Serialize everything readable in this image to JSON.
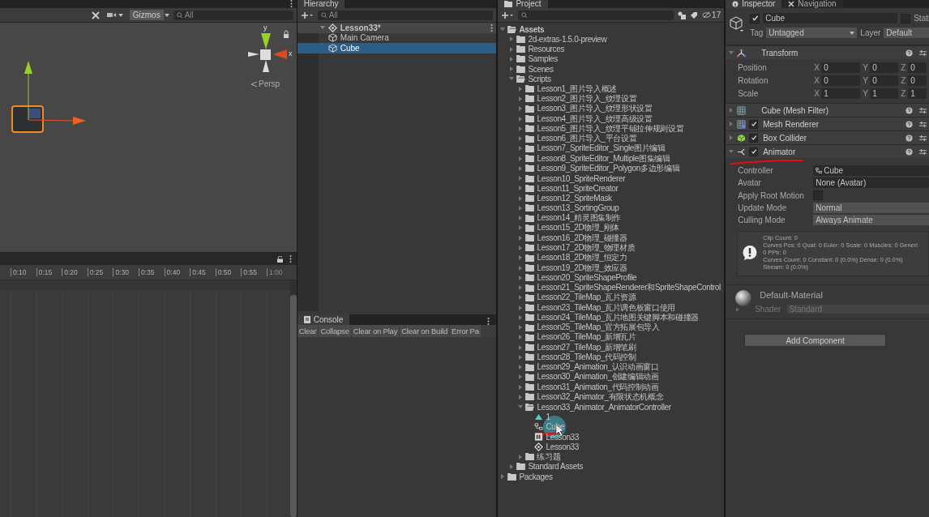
{
  "scene": {
    "toolbar": {
      "gizmos": "Gizmos",
      "search_placeholder": "All"
    },
    "orientation_labels": [
      "y",
      "x"
    ],
    "projection": "Persp"
  },
  "timeline": {
    "ticks": [
      "0:10",
      "0:15",
      "0:20",
      "0:25",
      "0:30",
      "0:35",
      "0:40",
      "0:45",
      "0:50",
      "0:55",
      "1:00"
    ]
  },
  "hierarchy": {
    "title": "Hierarchy",
    "search_placeholder": "All",
    "items": [
      {
        "kind": "scene",
        "label": "Lesson33*",
        "expanded": true,
        "selected": false,
        "children": [
          {
            "kind": "gameobject",
            "label": "Main Camera",
            "selected": false
          },
          {
            "kind": "gameobject",
            "label": "Cube",
            "selected": true
          }
        ]
      }
    ]
  },
  "console": {
    "title": "Console",
    "buttons": [
      "Clear",
      "Collapse",
      "Clear on Play",
      "Clear on Build",
      "Error Pa"
    ]
  },
  "project": {
    "title": "Project",
    "hidden_count": "17",
    "tree": [
      {
        "kind": "folder",
        "label": "Assets",
        "expanded": true,
        "children": [
          {
            "kind": "folder",
            "label": "2d-extras-1.5.0-preview",
            "expanded": false
          },
          {
            "kind": "folder",
            "label": "Resources",
            "expanded": false
          },
          {
            "kind": "folder",
            "label": "Samples",
            "expanded": false
          },
          {
            "kind": "folder",
            "label": "Scenes",
            "expanded": false
          },
          {
            "kind": "folder",
            "label": "Scripts",
            "expanded": true,
            "children": [
              {
                "kind": "folder",
                "label": "Lesson1_图片导入概述",
                "expanded": false
              },
              {
                "kind": "folder",
                "label": "Lesson2_图片导入_纹理设置",
                "expanded": false
              },
              {
                "kind": "folder",
                "label": "Lesson3_图片导入_纹理形状设置",
                "expanded": false
              },
              {
                "kind": "folder",
                "label": "Lesson4_图片导入_纹理高级设置",
                "expanded": false
              },
              {
                "kind": "folder",
                "label": "Lesson5_图片导入_纹理平铺拉伸规则设置",
                "expanded": false
              },
              {
                "kind": "folder",
                "label": "Lesson6_图片导入_平台设置",
                "expanded": false
              },
              {
                "kind": "folder",
                "label": "Lesson7_SpriteEditor_Single图片编辑",
                "expanded": false
              },
              {
                "kind": "folder",
                "label": "Lesson8_SpriteEditor_Multiple图集编辑",
                "expanded": false
              },
              {
                "kind": "folder",
                "label": "Lesson9_SpriteEditor_Polygon多边形编辑",
                "expanded": false
              },
              {
                "kind": "folder",
                "label": "Lesson10_SpriteRenderer",
                "expanded": false
              },
              {
                "kind": "folder",
                "label": "Lesson11_SpriteCreator",
                "expanded": false
              },
              {
                "kind": "folder",
                "label": "Lesson12_SpriteMask",
                "expanded": false
              },
              {
                "kind": "folder",
                "label": "Lesson13_SortingGroup",
                "expanded": false
              },
              {
                "kind": "folder",
                "label": "Lesson14_精灵图集制作",
                "expanded": false
              },
              {
                "kind": "folder",
                "label": "Lesson15_2D物理_刚体",
                "expanded": false
              },
              {
                "kind": "folder",
                "label": "Lesson16_2D物理_碰撞器",
                "expanded": false
              },
              {
                "kind": "folder",
                "label": "Lesson17_2D物理_物理材质",
                "expanded": false
              },
              {
                "kind": "folder",
                "label": "Lesson18_2D物理_恒定力",
                "expanded": false
              },
              {
                "kind": "folder",
                "label": "Lesson19_2D物理_效应器",
                "expanded": false
              },
              {
                "kind": "folder",
                "label": "Lesson20_SpriteShapeProfile",
                "expanded": false
              },
              {
                "kind": "folder",
                "label": "Lesson21_SpriteShapeRenderer和SpriteShapeControl",
                "expanded": false
              },
              {
                "kind": "folder",
                "label": "Lesson22_TileMap_瓦片资源",
                "expanded": false
              },
              {
                "kind": "folder",
                "label": "Lesson23_TileMap_瓦片调色板窗口使用",
                "expanded": false
              },
              {
                "kind": "folder",
                "label": "Lesson24_TileMap_瓦片地图关键脚本和碰撞器",
                "expanded": false
              },
              {
                "kind": "folder",
                "label": "Lesson25_TileMap_官方拓展包导入",
                "expanded": false
              },
              {
                "kind": "folder",
                "label": "Lesson26_TileMap_新增瓦片",
                "expanded": false
              },
              {
                "kind": "folder",
                "label": "Lesson27_TileMap_新增笔刷",
                "expanded": false
              },
              {
                "kind": "folder",
                "label": "Lesson28_TileMap_代码控制",
                "expanded": false
              },
              {
                "kind": "folder",
                "label": "Lesson29_Animation_认识动画窗口",
                "expanded": false
              },
              {
                "kind": "folder",
                "label": "Lesson30_Animation_创建编辑动画",
                "expanded": false
              },
              {
                "kind": "folder",
                "label": "Lesson31_Animation_代码控制动画",
                "expanded": false
              },
              {
                "kind": "folder",
                "label": "Lesson32_Animator_有限状态机概念",
                "expanded": false
              },
              {
                "kind": "folder",
                "label": "Lesson33_Animator_AnimatorController",
                "expanded": true,
                "children": [
                  {
                    "kind": "clip",
                    "label": "1"
                  },
                  {
                    "kind": "controller",
                    "label": "Cube"
                  },
                  {
                    "kind": "script",
                    "label": "Lesson33"
                  },
                  {
                    "kind": "scene",
                    "label": "Lesson33"
                  }
                ]
              },
              {
                "kind": "folder",
                "label": "练习题",
                "expanded": false
              }
            ]
          },
          {
            "kind": "folder",
            "label": "Standard Assets",
            "expanded": false
          }
        ]
      },
      {
        "kind": "folder",
        "label": "Packages",
        "expanded": false
      }
    ]
  },
  "inspector": {
    "tabs": [
      {
        "label": "Inspector",
        "selected": true
      },
      {
        "label": "Navigation",
        "selected": false
      }
    ],
    "object": {
      "active": true,
      "name": "Cube",
      "static": false,
      "static_label": "Stati",
      "tag_label": "Tag",
      "tag": "Untagged",
      "layer_label": "Layer",
      "layer": "Default"
    },
    "components": [
      {
        "kind": "transform",
        "title": "Transform",
        "expanded": true,
        "rows": [
          {
            "label": "Position",
            "values": [
              {
                "axis": "X",
                "value": "0"
              },
              {
                "axis": "Y",
                "value": "0"
              },
              {
                "axis": "Z",
                "value": "0"
              }
            ]
          },
          {
            "label": "Rotation",
            "values": [
              {
                "axis": "X",
                "value": "0"
              },
              {
                "axis": "Y",
                "value": "0"
              },
              {
                "axis": "Z",
                "value": "0"
              }
            ]
          },
          {
            "label": "Scale",
            "values": [
              {
                "axis": "X",
                "value": "1"
              },
              {
                "axis": "Y",
                "value": "1"
              },
              {
                "axis": "Z",
                "value": "1"
              }
            ]
          }
        ]
      },
      {
        "kind": "mesh_filter",
        "title": "Cube (Mesh Filter)",
        "expanded": false
      },
      {
        "kind": "mesh_renderer",
        "title": "Mesh Renderer",
        "enabled": true,
        "expanded": false
      },
      {
        "kind": "box_collider",
        "title": "Box Collider",
        "enabled": true,
        "expanded": false
      },
      {
        "kind": "animator",
        "title": "Animator",
        "enabled": true,
        "expanded": true,
        "fields": [
          {
            "kind": "object",
            "label": "Controller",
            "value": "Cube"
          },
          {
            "kind": "object",
            "label": "Avatar",
            "value": "None (Avatar)"
          },
          {
            "kind": "checkbox",
            "label": "Apply Root Motion",
            "checked": false
          },
          {
            "kind": "dropdown",
            "label": "Update Mode",
            "value": "Normal"
          },
          {
            "kind": "dropdown",
            "label": "Culling Mode",
            "value": "Always Animate"
          }
        ],
        "info": [
          "Clip Count: 0",
          "Curves Pos: 0 Quat: 0 Euler: 0 Scale: 0 Muscles: 0 Generi",
          "0 PPtr: 0",
          "Curves Count: 0 Constant: 0 (0.0%) Dense: 0 (0.0%)",
          "Stream: 0 (0.0%)"
        ]
      }
    ],
    "material": {
      "name": "Default-Material",
      "shader_label": "Shader",
      "shader": "Standard"
    },
    "add_component": "Add Component"
  }
}
